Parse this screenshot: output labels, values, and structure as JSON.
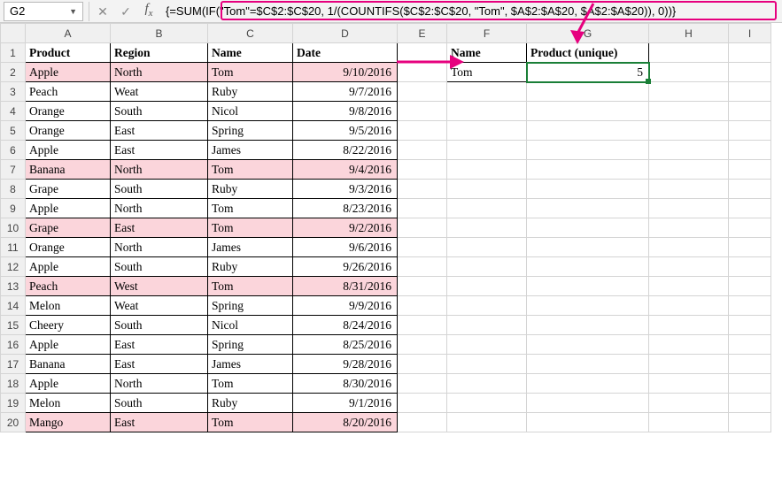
{
  "name_box": "G2",
  "formula": "{=SUM(IF(\"Tom\"=$C$2:$C$20, 1/(COUNTIFS($C$2:$C$20, \"Tom\", $A$2:$A$20, $A$2:$A$20)), 0))}",
  "columns": [
    "A",
    "B",
    "C",
    "D",
    "E",
    "F",
    "G",
    "H",
    "I"
  ],
  "main_header": {
    "a": "Product",
    "b": "Region",
    "c": "Name",
    "d": "Date"
  },
  "side_header": {
    "f": "Name",
    "g": "Product (unique)"
  },
  "side_row": {
    "f": "Tom",
    "g": "5"
  },
  "rows": [
    {
      "n": "1"
    },
    {
      "n": "2",
      "a": "Apple",
      "b": "North",
      "c": "Tom",
      "d": "9/10/2016",
      "hl": true
    },
    {
      "n": "3",
      "a": "Peach",
      "b": "Weat",
      "c": "Ruby",
      "d": "9/7/2016"
    },
    {
      "n": "4",
      "a": "Orange",
      "b": "South",
      "c": "Nicol",
      "d": "9/8/2016"
    },
    {
      "n": "5",
      "a": "Orange",
      "b": "East",
      "c": "Spring",
      "d": "9/5/2016"
    },
    {
      "n": "6",
      "a": "Apple",
      "b": "East",
      "c": "James",
      "d": "8/22/2016"
    },
    {
      "n": "7",
      "a": "Banana",
      "b": "North",
      "c": "Tom",
      "d": "9/4/2016",
      "hl": true
    },
    {
      "n": "8",
      "a": "Grape",
      "b": "South",
      "c": "Ruby",
      "d": "9/3/2016"
    },
    {
      "n": "9",
      "a": "Apple",
      "b": "North",
      "c": "Tom",
      "d": "8/23/2016"
    },
    {
      "n": "10",
      "a": "Grape",
      "b": "East",
      "c": "Tom",
      "d": "9/2/2016",
      "hl": true
    },
    {
      "n": "11",
      "a": "Orange",
      "b": "North",
      "c": "James",
      "d": "9/6/2016"
    },
    {
      "n": "12",
      "a": "Apple",
      "b": "South",
      "c": "Ruby",
      "d": "9/26/2016"
    },
    {
      "n": "13",
      "a": "Peach",
      "b": "West",
      "c": "Tom",
      "d": "8/31/2016",
      "hl": true
    },
    {
      "n": "14",
      "a": "Melon",
      "b": "Weat",
      "c": "Spring",
      "d": "9/9/2016"
    },
    {
      "n": "15",
      "a": "Cheery",
      "b": "South",
      "c": "Nicol",
      "d": "8/24/2016"
    },
    {
      "n": "16",
      "a": "Apple",
      "b": "East",
      "c": "Spring",
      "d": "8/25/2016"
    },
    {
      "n": "17",
      "a": "Banana",
      "b": "East",
      "c": "James",
      "d": "9/28/2016"
    },
    {
      "n": "18",
      "a": "Apple",
      "b": "North",
      "c": "Tom",
      "d": "8/30/2016"
    },
    {
      "n": "19",
      "a": "Melon",
      "b": "South",
      "c": "Ruby",
      "d": "9/1/2016"
    },
    {
      "n": "20",
      "a": "Mango",
      "b": "East",
      "c": "Tom",
      "d": "8/20/2016",
      "hl": true
    }
  ],
  "colors": {
    "highlight_row": "#fbd5db",
    "annotation": "#e6007e",
    "active_border": "#1a7f37"
  }
}
